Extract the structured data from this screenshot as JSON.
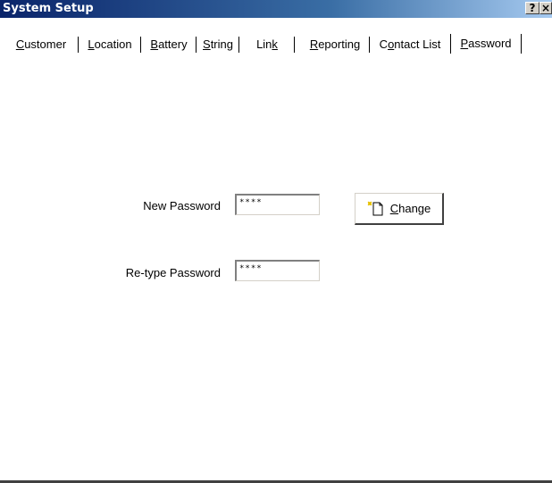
{
  "window": {
    "title": "System Setup",
    "help_label": "?",
    "close_label": "×"
  },
  "tabs": [
    {
      "pre": "",
      "accel": "C",
      "post": "ustomer"
    },
    {
      "pre": "",
      "accel": "L",
      "post": "ocation"
    },
    {
      "pre": "",
      "accel": "B",
      "post": "attery"
    },
    {
      "pre": "",
      "accel": "S",
      "post": "tring"
    },
    {
      "pre": "Lin",
      "accel": "k",
      "post": ""
    },
    {
      "pre": "",
      "accel": "R",
      "post": "eporting"
    },
    {
      "pre": "C",
      "accel": "o",
      "post": "ntact List"
    },
    {
      "pre": "",
      "accel": "P",
      "post": "assword"
    }
  ],
  "active_tab": "Password",
  "form": {
    "new_password_label": "New Password",
    "new_password_value": "****",
    "retype_password_label": "Re-type Password",
    "retype_password_value": "****"
  },
  "change_button": {
    "accel": "C",
    "rest": "hange",
    "icon": "new-document-icon"
  }
}
